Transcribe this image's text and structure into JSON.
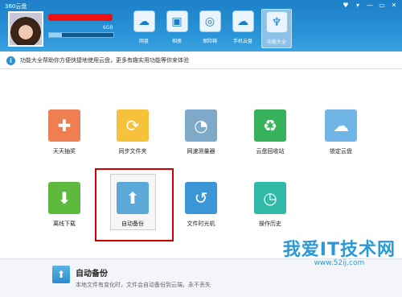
{
  "window": {
    "title": "360云盘",
    "controls": [
      "♥",
      "▾",
      "—",
      "▭",
      "✕"
    ]
  },
  "user": {
    "quota_text": "6GB",
    "quota_fraction": 0.2
  },
  "top_nav": [
    {
      "label": "网盘",
      "icon": "cloud-drive-icon",
      "glyph": "☁"
    },
    {
      "label": "相册",
      "icon": "photo-icon",
      "glyph": "▣"
    },
    {
      "label": "保险箱",
      "icon": "safe-icon",
      "glyph": "◎"
    },
    {
      "label": "手机云盘",
      "icon": "mobile-cloud-icon",
      "glyph": "☁"
    },
    {
      "label": "功能大全",
      "icon": "toolbox-icon",
      "glyph": "♆",
      "active": true
    }
  ],
  "info_bar": {
    "icon": "info-icon",
    "text": "功能大全帮助你方便快捷地使用云盘，更多有趣实用功能等你来体验"
  },
  "features": [
    {
      "label": "天天抽奖",
      "icon": "lottery-icon",
      "color": "#ef7f52",
      "glyph": "✚"
    },
    {
      "label": "同步文件夹",
      "icon": "sync-folder-icon",
      "color": "#f6c23a",
      "glyph": "⟳"
    },
    {
      "label": "网速测量器",
      "icon": "speedometer-icon",
      "color": "#7fa9c9",
      "glyph": "◔"
    },
    {
      "label": "云盘回收站",
      "icon": "recycle-bin-icon",
      "color": "#37b25a",
      "glyph": "♻"
    },
    {
      "label": "锁定云盘",
      "icon": "lock-cloud-icon",
      "color": "#6fb6e6",
      "glyph": "☁"
    },
    {
      "label": "离线下载",
      "icon": "offline-download-icon",
      "color": "#5eba3c",
      "glyph": "⬇"
    },
    {
      "label": "自动备份",
      "icon": "auto-backup-icon",
      "color": "#5aa9d9",
      "glyph": "⬆"
    },
    {
      "label": "文件时光机",
      "icon": "time-machine-icon",
      "color": "#3a96d6",
      "glyph": "↺"
    },
    {
      "label": "操作历史",
      "icon": "history-icon",
      "color": "#30b9a6",
      "glyph": "◷"
    }
  ],
  "footer": {
    "title": "自动备份",
    "description": "本地文件有变化时，文件会自动备份到云端，永不丢失"
  },
  "watermark": {
    "main": "我爱IT技术网",
    "sub": "www.52ij.com"
  }
}
